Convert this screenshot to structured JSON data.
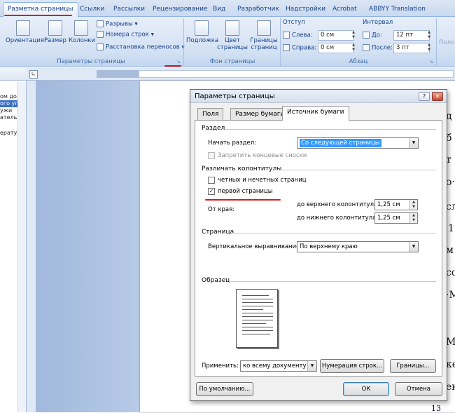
{
  "ribbon": {
    "tabs": [
      "Разметка страницы",
      "Ссылки",
      "Рассылки",
      "Рецензирование",
      "Вид",
      "Разработчик",
      "Надстройки",
      "Acrobat",
      "ABBYY Translation"
    ],
    "active_tab": "Разметка страницы",
    "page_setup_group": {
      "buttons": [
        "Ориентация",
        "Размер",
        "Колонки"
      ],
      "small_items": [
        "Разрывы ▾",
        "Номера строк ▾",
        "Расстановка переносов ▾"
      ],
      "label": "Параметры страницы"
    },
    "page_bg_group": {
      "buttons": [
        "Подложка",
        "Цвет страницы",
        "Границы страниц"
      ],
      "label": "Фон страницы"
    },
    "paragraph_group": {
      "indent_title": "Отступ",
      "left_label": "Слева:",
      "left_value": "0 см",
      "right_label": "Справа:",
      "right_value": "0 см",
      "spacing_title": "Интервал",
      "before_label": "До:",
      "before_value": "12 пт",
      "after_label": "После:",
      "after_value": "3 пт",
      "label": "Абзац"
    },
    "cut_label": "Поло"
  },
  "left_pane": {
    "lines": [
      {
        "text": "ом до",
        "highlight": false
      },
      {
        "text": "ого уп",
        "highlight": true
      },
      {
        "text": "ужи",
        "highlight": false
      },
      {
        "text": "ательн",
        "highlight": false
      },
      {
        "text": "ерату",
        "highlight": false
      }
    ]
  },
  "document": {
    "chars": [
      "д",
      "б",
      "т",
      "о·",
      "сл",
      "1",
      "м",
      "со",
      "·М",
      "Ма",
      "ке",
      "ен"
    ],
    "page_number": "13"
  },
  "dialog": {
    "title": "Параметры страницы",
    "help_btn": "?",
    "close_btn": "✕",
    "tabs": [
      "Поля",
      "Размер бумаги",
      "Источник бумаги"
    ],
    "active_tab": "Источник бумаги",
    "section_title": "Раздел",
    "start_label": "Начать раздел:",
    "start_value": "Со следующей страницы",
    "suppress_endnotes": "Запретить концевые сноски",
    "headers_title": "Различать колонтитулы",
    "odd_even": "четных и нечетных страниц",
    "odd_even_checked": false,
    "first_page": "первой страницы",
    "first_page_checked": true,
    "from_edge": "От края:",
    "header_label": "до верхнего колонтитула:",
    "header_value": "1,25 см",
    "footer_label": "до нижнего колонтитула:",
    "footer_value": "1,25 см",
    "page_title": "Страница",
    "valign_label": "Вертикальное выравнивание:",
    "valign_value": "По верхнему краю",
    "sample_title": "Образец",
    "apply_label": "Применить:",
    "apply_value": "ко всему документу",
    "line_numbers_btn": "Нумерация строк...",
    "borders_btn": "Границы...",
    "default_btn": "По умолчанию...",
    "ok_btn": "ОК",
    "cancel_btn": "Отмена"
  },
  "colors": {
    "annotation": "#e01818",
    "ribbon_text": "#15428b",
    "selection": "#3399ff"
  }
}
